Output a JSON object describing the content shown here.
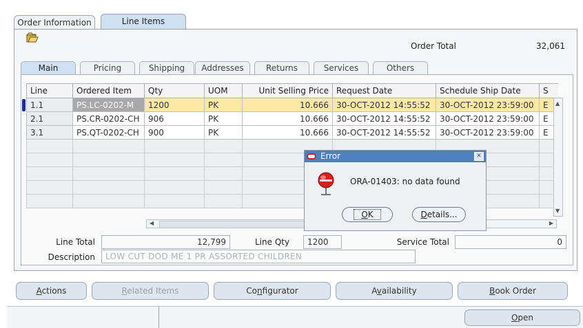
{
  "tabs": [
    {
      "label": "Order Information",
      "active": false
    },
    {
      "label": "Line Items",
      "active": true
    }
  ],
  "header": {
    "order_total_label": "Order Total",
    "order_total_value": "32,061"
  },
  "subtabs": [
    "Main",
    "Pricing",
    "Shipping",
    "Addresses",
    "Returns",
    "Services",
    "Others"
  ],
  "grid": {
    "columns": [
      "Line",
      "Ordered Item",
      "Qty",
      "UOM",
      "Unit Selling Price",
      "Request Date",
      "Schedule Ship Date",
      "S"
    ],
    "rows": [
      {
        "line": "1.1",
        "item": "PS.LC-0202-M",
        "qty": "1200",
        "uom": "PK",
        "price": "10.666",
        "request": "30-OCT-2012 14:55:52",
        "ship": "30-OCT-2012 23:59:00",
        "s": "E"
      },
      {
        "line": "2.1",
        "item": "PS.CR-0202-CH",
        "qty": "906",
        "uom": "PK",
        "price": "10.666",
        "request": "30-OCT-2012 14:55:52",
        "ship": "30-OCT-2012 23:59:00",
        "s": "E"
      },
      {
        "line": "3.1",
        "item": "PS.QT-0202-CH",
        "qty": "900",
        "uom": "PK",
        "price": "10.666",
        "request": "30-OCT-2012 14:55:52",
        "ship": "30-OCT-2012 23:59:00",
        "s": "E"
      }
    ]
  },
  "totals": {
    "line_total_label": "Line Total",
    "line_total_value": "12,799",
    "line_qty_label": "Line Qty",
    "line_qty_value": "1200",
    "service_total_label": "Service Total",
    "service_total_value": "0",
    "description_label": "Description",
    "description_value": "LOW CUT DOD ME 1 PR ASSORTED CHILDREN"
  },
  "dialog": {
    "title": "Error",
    "message": "ORA-01403: no data found",
    "ok_label": "OK",
    "details_label": "Details..."
  },
  "buttons": {
    "actions": "Actions",
    "related_items": "Related Items",
    "configurator": "Configurator",
    "availability": "Availability",
    "book_order": "Book Order",
    "open": "Open"
  },
  "icons": {
    "folder": "open-folder-icon",
    "alert": "stop-alert-icon"
  }
}
